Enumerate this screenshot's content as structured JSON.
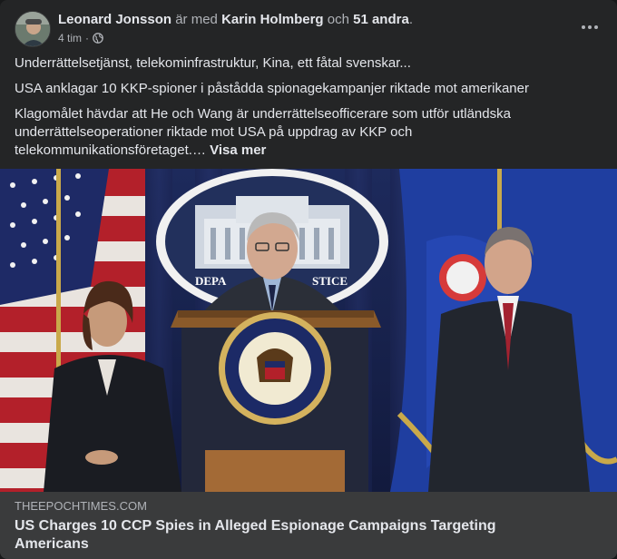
{
  "header": {
    "author": "Leonard Jonsson",
    "with_text": "är med",
    "tagged_person": "Karin Holmberg",
    "and_text": "och",
    "others": "51 andra",
    "period": ".",
    "timestamp": "4 tim",
    "dot": "·",
    "privacy_icon": "globe-icon",
    "more_icon": "more-options-icon"
  },
  "post": {
    "line1": "Underrättelsetjänst, telekominfrastruktur,  Kina,  ett fåtal svenskar...",
    "line2": "USA anklagar 10 KKP-spioner i påstådda spionagekampanjer riktade mot amerikaner",
    "line3": "Klagomålet hävdar att He och Wang är underrättelseofficerare som utför utländska underrättelseoperationer riktade mot USA på uppdrag av KKP och telekommunikationsföretaget.…",
    "see_more": "Visa mer"
  },
  "image": {
    "seal_text": "DEPARTMENT OF JUSTICE",
    "sign_text": "DEPARTMENT OF JUSTICE"
  },
  "link": {
    "domain": "THEEPOCHTIMES.COM",
    "title": "US Charges 10 CCP Spies in Alleged Espionage Campaigns Targeting Americans"
  },
  "colors": {
    "background": "#242526",
    "text_primary": "#e4e6eb",
    "text_secondary": "#b0b3b8",
    "link_bg": "#3a3b3c"
  }
}
